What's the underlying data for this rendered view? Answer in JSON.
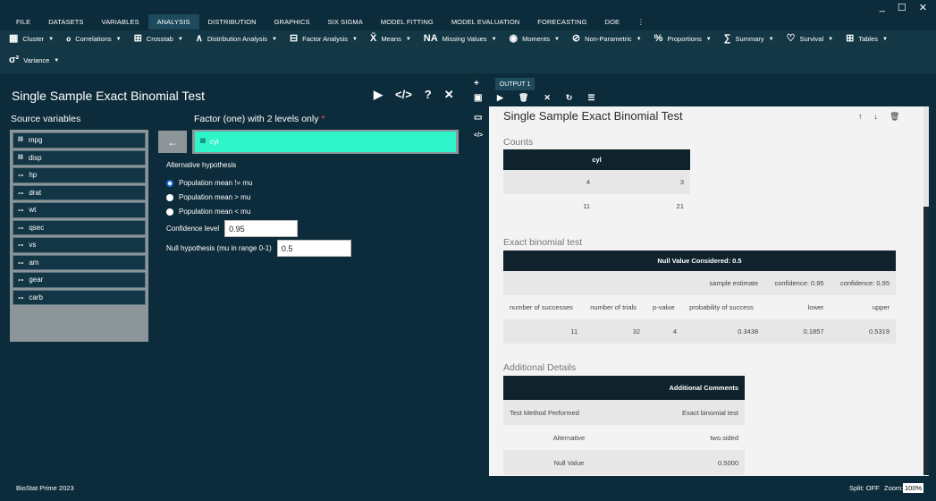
{
  "menu": [
    "FILE",
    "DATASETS",
    "VARIABLES",
    "ANALYSIS",
    "DISTRIBUTION",
    "GRAPHICS",
    "SIX SIGMA",
    "MODEL FITTING",
    "MODEL EVALUATION",
    "FORECASTING",
    "DOE"
  ],
  "menu_active": "ANALYSIS",
  "window_controls": {
    "minimize": "_",
    "maximize": "☐",
    "close": "✕"
  },
  "toolbar": {
    "row1": [
      {
        "label": "Cluster",
        "icon": "cluster-icon",
        "glyph": "▦"
      },
      {
        "label": "Correlations",
        "icon": "correlations-icon",
        "glyph": "ℴ"
      },
      {
        "label": "Crosstab",
        "icon": "crosstab-icon",
        "glyph": "⊞"
      },
      {
        "label": "Distribution Analysis",
        "icon": "distribution-icon",
        "glyph": "∧"
      },
      {
        "label": "Factor Analysis",
        "icon": "factor-analysis-icon",
        "glyph": "⊟"
      },
      {
        "label": "Means",
        "icon": "means-icon",
        "glyph": "X̄"
      },
      {
        "label": "Missing Values",
        "icon": "missing-values-icon",
        "glyph": "NA"
      },
      {
        "label": "Moments",
        "icon": "moments-icon",
        "glyph": "◉"
      },
      {
        "label": "Non-Parametric",
        "icon": "non-parametric-icon",
        "glyph": "⊘"
      },
      {
        "label": "Proportions",
        "icon": "proportions-icon",
        "glyph": "%"
      },
      {
        "label": "Summary",
        "icon": "summary-icon",
        "glyph": "∑"
      },
      {
        "label": "Survival",
        "icon": "survival-icon",
        "glyph": "♡"
      },
      {
        "label": "Tables",
        "icon": "tables-icon",
        "glyph": "⊞"
      }
    ],
    "row2": [
      {
        "label": "Variance",
        "icon": "variance-icon",
        "glyph": "σ²"
      }
    ]
  },
  "dialog": {
    "title": "Single Sample Exact Binomial Test",
    "source_label": "Source variables",
    "source_vars": [
      {
        "name": "mpg",
        "type": "scale"
      },
      {
        "name": "disp",
        "type": "scale"
      },
      {
        "name": "hp",
        "type": "ordinal"
      },
      {
        "name": "drat",
        "type": "ordinal"
      },
      {
        "name": "wt",
        "type": "ordinal"
      },
      {
        "name": "qsec",
        "type": "ordinal"
      },
      {
        "name": "vs",
        "type": "ordinal"
      },
      {
        "name": "am",
        "type": "ordinal"
      },
      {
        "name": "gear",
        "type": "ordinal"
      },
      {
        "name": "carb",
        "type": "ordinal"
      }
    ],
    "factor_label": "Factor (one) with 2 levels only",
    "factor_required": "*",
    "factor_value": "cyl",
    "alt_hyp_label": "Alternative hypothesis",
    "options": [
      "Population mean != mu",
      "Population mean > mu",
      "Population mean < mu"
    ],
    "selected_option": 0,
    "confidence_label": "Confidence level",
    "confidence_value": "0.95",
    "null_label": "Null hypothesis (mu in range 0-1)",
    "null_value": "0.5"
  },
  "output": {
    "tab": "OUTPUT 1",
    "title": "Single Sample Exact Binomial Test",
    "counts": {
      "heading": "Counts",
      "col": "cyl",
      "rows": [
        [
          "4",
          "3"
        ],
        [
          "11",
          "21"
        ]
      ]
    },
    "exact": {
      "heading": "Exact binomial test",
      "header": "Null Value Considered: 0.5",
      "subheaders": [
        "",
        "",
        "",
        "sample estimate",
        "confidence: 0.95",
        "confidence: 0.95"
      ],
      "columns": [
        "number of successes",
        "number of trials",
        "p-value",
        "probability of success",
        "lower",
        "upper"
      ],
      "row": [
        "11",
        "32",
        "4",
        "0.3438",
        "0.1857",
        "0.5319"
      ]
    },
    "details": {
      "heading": "Additional Details",
      "header": "Additional Comments",
      "rows": [
        [
          "Test Method Performed",
          "Exact binomial test"
        ],
        [
          "Alternative",
          "two.sided"
        ],
        [
          "Null Value",
          "0.5000"
        ]
      ]
    }
  },
  "status": {
    "app": "BioStat Prime 2023",
    "split": "Split: OFF",
    "zoom_label": "Zoom:",
    "zoom_value": "100%"
  }
}
